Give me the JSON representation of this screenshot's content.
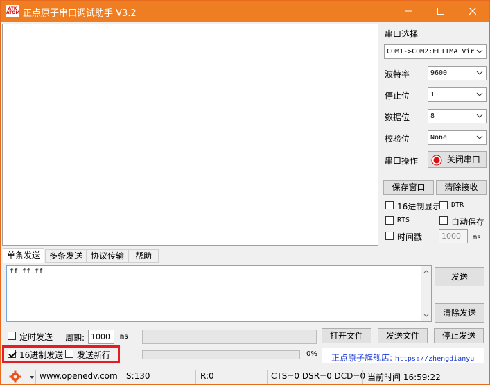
{
  "titlebar": {
    "logo_text": "ATK ATOM",
    "title": "正点原子串口调试助手 V3.2",
    "min_icon": "minimize-icon",
    "max_icon": "maximize-icon",
    "close_icon": "close-icon"
  },
  "serial": {
    "port_label": "串口选择",
    "port_value": "COM1->COM2:ELTIMA Vir",
    "baud_label": "波特率",
    "baud_value": "9600",
    "stop_label": "停止位",
    "stop_value": "1",
    "data_label": "数据位",
    "data_value": "8",
    "parity_label": "校验位",
    "parity_value": "None",
    "op_label": "串口操作",
    "op_button": "关闭串口",
    "save_button": "保存窗口",
    "clear_rx_button": "清除接收",
    "hex_display": "16进制显示",
    "dtr": "DTR",
    "rts": "RTS",
    "auto_save": "自动保存",
    "timestamp": "时间戳",
    "timestamp_value": "1000",
    "timestamp_unit": "ms"
  },
  "tabs": [
    "单条发送",
    "多条发送",
    "协议传输",
    "帮助"
  ],
  "send": {
    "text": "ff ff ff",
    "send_button": "发送",
    "clear_send_button": "清除发送",
    "timed_send": "定时发送",
    "period_label": "周期:",
    "period_value": "1000",
    "period_unit": "ms",
    "open_file": "打开文件",
    "send_file": "发送文件",
    "stop_send": "停止发送",
    "hex_send": "16进制发送",
    "send_newline": "发送新行",
    "progress": "0%",
    "shop_label": "正点原子旗舰店:",
    "shop_url": "https://zhengdianyu"
  },
  "status": {
    "gear_icon": "gear-icon",
    "url": "www.openedv.com",
    "s_count": "S:130",
    "r_count": "R:0",
    "lines": "CTS=0 DSR=0 DCD=0",
    "time": "当前时间 16:59:22"
  }
}
